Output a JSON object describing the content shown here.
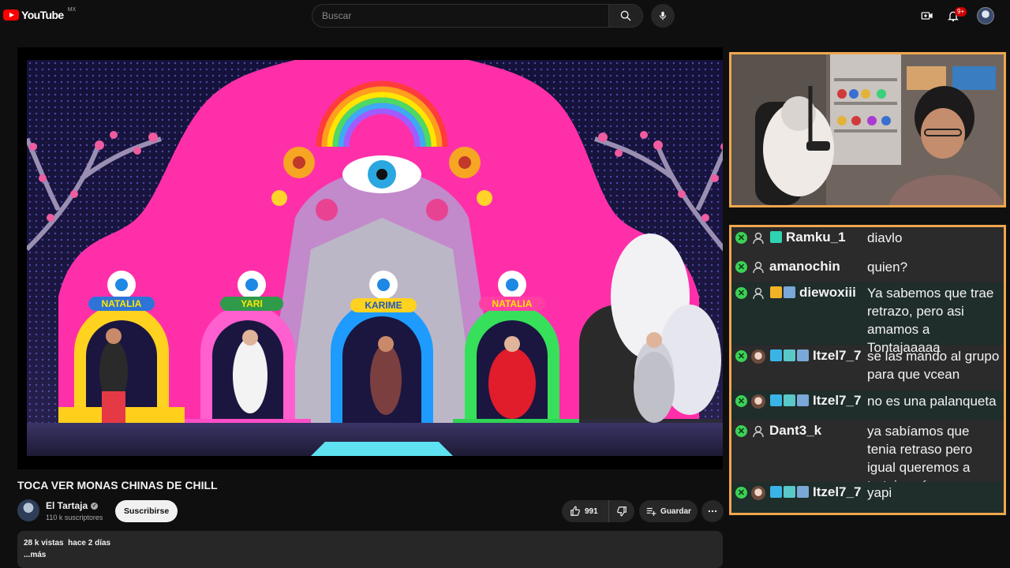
{
  "header": {
    "logo_text": "YouTube",
    "country": "MX",
    "search_placeholder": "Buscar",
    "notifications_badge": "9+"
  },
  "video": {
    "title": "TOCA VER MONAS CHINAS DE CHILL",
    "channel_name": "El Tartaja",
    "subscribers": "110 k suscriptores",
    "subscribe_label": "Suscribirse",
    "likes": "991",
    "save_label": "Guardar",
    "views": "28 k vistas",
    "uploaded": "hace 2 días",
    "more_label": "...más"
  },
  "stage": {
    "name_signs": [
      "NATALIA",
      "YARI",
      "KARIME",
      "NATALIA"
    ]
  },
  "chat": {
    "accent_color": "#f0a64e",
    "messages": [
      {
        "user": "Ramku_1",
        "text": "diavlo",
        "avatar": "person-icon",
        "badges": [
          "teal"
        ],
        "alt": false
      },
      {
        "user": "amanochin",
        "text": "quien?",
        "avatar": "person-icon",
        "badges": [],
        "alt": false
      },
      {
        "user": "diewoxiii",
        "text": "Ya sabemos que trae retrazo, pero asi amamos a Tontajaaaaa",
        "avatar": "person-icon",
        "badges": [
          "crown",
          "sticker"
        ],
        "alt": true
      },
      {
        "user": "Itzel7_7",
        "text": "se las mando al grupo para que vcean",
        "avatar": "photo",
        "badges": [
          "tool",
          "bits",
          "sticker"
        ],
        "alt": false
      },
      {
        "user": "Itzel7_7",
        "text": "no es una palanqueta",
        "avatar": "photo",
        "badges": [
          "tool",
          "bits",
          "sticker"
        ],
        "alt": true
      },
      {
        "user": "Dant3_k",
        "text": "ya sabíamos que tenia retraso pero igual queremos a tartaja así",
        "avatar": "person-icon",
        "badges": [],
        "alt": false
      },
      {
        "user": "Itzel7_7",
        "text": "yapi",
        "avatar": "photo",
        "badges": [
          "tool",
          "bits",
          "sticker"
        ],
        "alt": true
      }
    ]
  }
}
